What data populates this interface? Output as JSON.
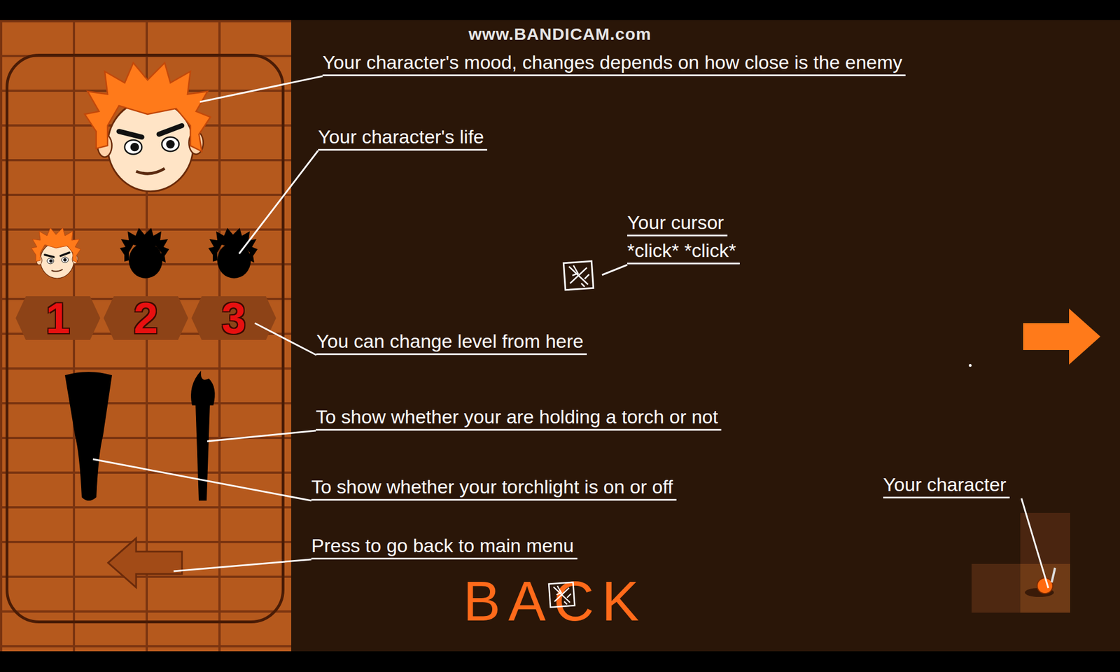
{
  "watermark": "www.BANDICAM.com",
  "player": {
    "lives": [
      {
        "alive": true
      },
      {
        "alive": false
      },
      {
        "alive": false
      }
    ],
    "holding_torch": false,
    "torchlight_on": false
  },
  "levels": [
    {
      "label": "1"
    },
    {
      "label": "2"
    },
    {
      "label": "3"
    }
  ],
  "annotations": [
    {
      "lines": [
        "Your character's mood, changes depends on how close is the enemy"
      ]
    },
    {
      "lines": [
        "Your character's life"
      ]
    },
    {
      "lines": [
        "Your cursor",
        "*click* *click*"
      ]
    },
    {
      "lines": [
        "You can change level from here"
      ]
    },
    {
      "lines": [
        "To show whether your are holding a torch or not"
      ]
    },
    {
      "lines": [
        "To show whether your torchlight is on or off"
      ]
    },
    {
      "lines": [
        "Press to go back to main menu"
      ]
    },
    {
      "lines": [
        "Your character"
      ]
    }
  ],
  "back": {
    "label": "BACK"
  }
}
